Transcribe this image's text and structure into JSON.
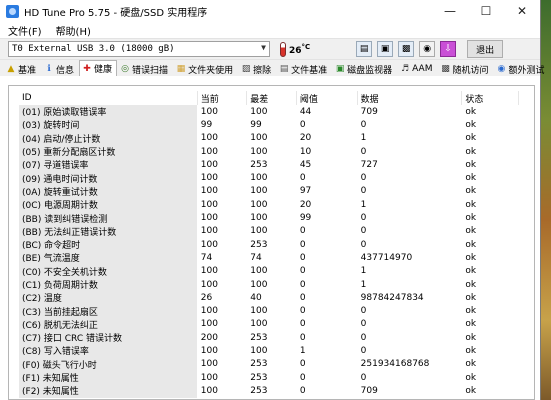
{
  "window": {
    "title": "HD Tune Pro 5.75 - 硬盘/SSD 实用程序"
  },
  "menu": [
    "文件(F)",
    "帮助(H)"
  ],
  "toolbar": {
    "drive": "T0 External USB 3.0 (18000 gB)",
    "temperature": "26",
    "temperature_unit": "°C",
    "exit_label": "退出"
  },
  "tabs": [
    {
      "label": "基准",
      "icon": "benchmark-icon"
    },
    {
      "label": "信息",
      "icon": "info-icon"
    },
    {
      "label": "健康",
      "icon": "health-icon"
    },
    {
      "label": "错误扫描",
      "icon": "error-scan-icon"
    },
    {
      "label": "文件夹使用",
      "icon": "folder-icon"
    },
    {
      "label": "擦除",
      "icon": "erase-icon"
    },
    {
      "label": "文件基准",
      "icon": "file-benchmark-icon"
    },
    {
      "label": "磁盘监视器",
      "icon": "disk-monitor-icon"
    },
    {
      "label": "AAM",
      "icon": "speaker-icon"
    },
    {
      "label": "随机访问",
      "icon": "random-access-icon"
    },
    {
      "label": "额外测试",
      "icon": "extra-tests-icon"
    }
  ],
  "table": {
    "headers": [
      "ID",
      "当前",
      "最差",
      "阈值",
      "数据",
      "状态"
    ],
    "rows": [
      [
        "(01) 原始读取错误率",
        "100",
        "100",
        "44",
        "709",
        "ok"
      ],
      [
        "(03) 旋转时间",
        "99",
        "99",
        "0",
        "0",
        "ok"
      ],
      [
        "(04) 启动/停止计数",
        "100",
        "100",
        "20",
        "1",
        "ok"
      ],
      [
        "(05) 重新分配扇区计数",
        "100",
        "100",
        "10",
        "0",
        "ok"
      ],
      [
        "(07) 寻道错误率",
        "100",
        "253",
        "45",
        "727",
        "ok"
      ],
      [
        "(09) 通电时间计数",
        "100",
        "100",
        "0",
        "0",
        "ok"
      ],
      [
        "(0A) 旋转重试计数",
        "100",
        "100",
        "97",
        "0",
        "ok"
      ],
      [
        "(0C) 电源周期计数",
        "100",
        "100",
        "20",
        "1",
        "ok"
      ],
      [
        "(BB) 读到纠错误检测",
        "100",
        "100",
        "99",
        "0",
        "ok"
      ],
      [
        "(BB) 无法纠正错误计数",
        "100",
        "100",
        "0",
        "0",
        "ok"
      ],
      [
        "(BC) 命令超时",
        "100",
        "253",
        "0",
        "0",
        "ok"
      ],
      [
        "(BE) 气流温度",
        "74",
        "74",
        "0",
        "437714970",
        "ok"
      ],
      [
        "(C0) 不安全关机计数",
        "100",
        "100",
        "0",
        "1",
        "ok"
      ],
      [
        "(C1) 负荷周期计数",
        "100",
        "100",
        "0",
        "1",
        "ok"
      ],
      [
        "(C2) 温度",
        "26",
        "40",
        "0",
        "98784247834",
        "ok"
      ],
      [
        "(C3) 当前挂起扇区",
        "100",
        "100",
        "0",
        "0",
        "ok"
      ],
      [
        "(C6) 脱机无法纠正",
        "100",
        "100",
        "0",
        "0",
        "ok"
      ],
      [
        "(C7) 接口 CRC 错误计数",
        "200",
        "253",
        "0",
        "0",
        "ok"
      ],
      [
        "(C8) 写入错误率",
        "100",
        "100",
        "1",
        "0",
        "ok"
      ],
      [
        "(F0) 磁头飞行小时",
        "100",
        "253",
        "0",
        "251934168768",
        "ok"
      ],
      [
        "(F1) 未知属性",
        "100",
        "253",
        "0",
        "0",
        "ok"
      ],
      [
        "(F2) 未知属性",
        "100",
        "253",
        "0",
        "709",
        "ok"
      ]
    ]
  }
}
